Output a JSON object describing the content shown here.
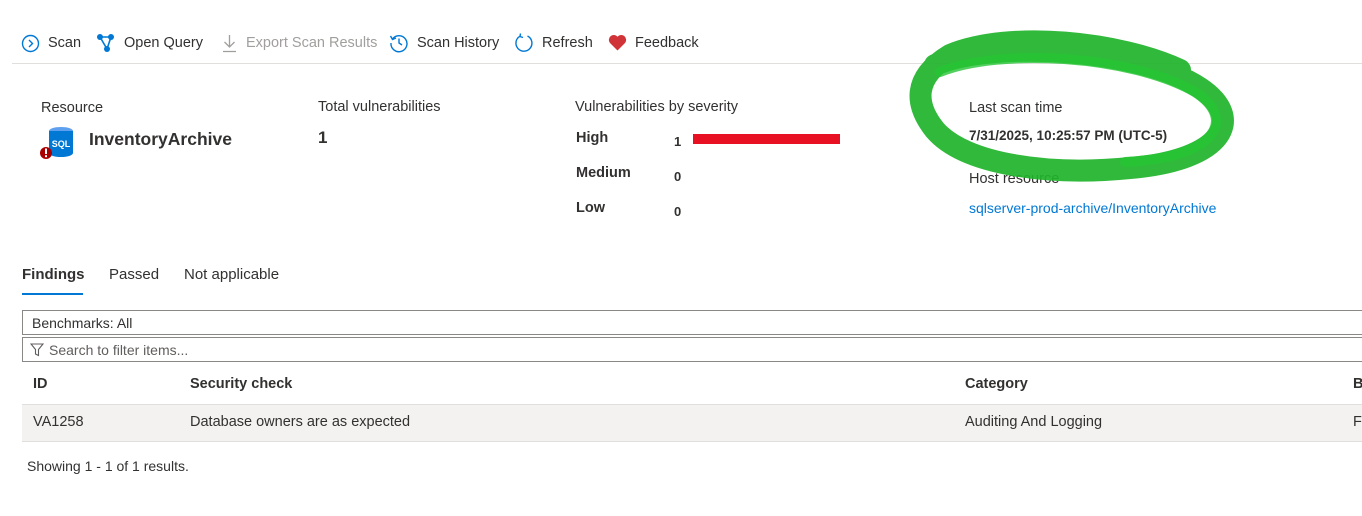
{
  "toolbar": {
    "scan": "Scan",
    "open_query": "Open Query",
    "export": "Export Scan Results",
    "history": "Scan History",
    "refresh": "Refresh",
    "feedback": "Feedback"
  },
  "summary": {
    "resource_label": "Resource",
    "resource_name": "InventoryArchive",
    "resource_icon_text": "SQL",
    "total_label": "Total vulnerabilities",
    "total_value": "1",
    "severity_label": "Vulnerabilities by severity",
    "severity": [
      {
        "name": "High",
        "count": "1"
      },
      {
        "name": "Medium",
        "count": "0"
      },
      {
        "name": "Low",
        "count": "0"
      }
    ],
    "last_scan_label": "Last scan time",
    "last_scan_value": "7/31/2025, 10:25:57 PM (UTC-5)",
    "host_label": "Host resource",
    "host_link": "sqlserver-prod-archive/InventoryArchive"
  },
  "tabs": [
    "Findings",
    "Passed",
    "Not applicable"
  ],
  "filters": {
    "benchmarks": "Benchmarks: All",
    "search_placeholder": "Search to filter items..."
  },
  "table": {
    "headers": [
      "ID",
      "Security check",
      "Category",
      "B"
    ],
    "rows": [
      [
        "VA1258",
        "Database owners are as expected",
        "Auditing And Logging",
        "F"
      ]
    ]
  },
  "footer": "Showing 1 - 1 of 1 results.",
  "colors": {
    "accent": "#0078d4",
    "high_bar": "#e81123",
    "feedback_heart": "#d13438",
    "scribble": "#1fb32a"
  }
}
